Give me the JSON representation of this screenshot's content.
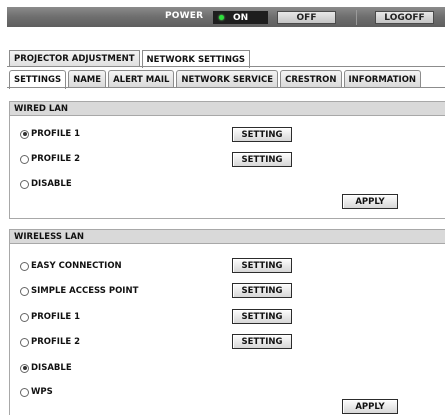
{
  "topbar": {
    "power_label": "POWER",
    "on_label": "ON",
    "off_label": "OFF",
    "logoff_label": "LOGOFF"
  },
  "main_tabs": [
    {
      "label": "PROJECTOR ADJUSTMENT",
      "active": false
    },
    {
      "label": "NETWORK SETTINGS",
      "active": true
    }
  ],
  "sub_tabs": [
    {
      "label": "SETTINGS",
      "active": true
    },
    {
      "label": "NAME",
      "active": false
    },
    {
      "label": "ALERT MAIL",
      "active": false
    },
    {
      "label": "NETWORK SERVICE",
      "active": false
    },
    {
      "label": "CRESTRON",
      "active": false
    },
    {
      "label": "INFORMATION",
      "active": false
    }
  ],
  "wired_lan": {
    "title": "WIRED LAN",
    "options": [
      {
        "label": "PROFILE 1",
        "checked": true,
        "button": "SETTING"
      },
      {
        "label": "PROFILE 2",
        "checked": false,
        "button": "SETTING"
      },
      {
        "label": "DISABLE",
        "checked": false
      }
    ],
    "apply_label": "APPLY"
  },
  "wireless_lan": {
    "title": "WIRELESS LAN",
    "options": [
      {
        "label": "EASY CONNECTION",
        "checked": false,
        "button": "SETTING"
      },
      {
        "label": "SIMPLE ACCESS POINT",
        "checked": false,
        "button": "SETTING"
      },
      {
        "label": "PROFILE 1",
        "checked": false,
        "button": "SETTING"
      },
      {
        "label": "PROFILE 2",
        "checked": false,
        "button": "SETTING"
      },
      {
        "label": "DISABLE",
        "checked": true
      },
      {
        "label": "WPS",
        "checked": false
      }
    ],
    "apply_label": "APPLY"
  },
  "colors": {
    "power_on_indicator": "#2ee03c",
    "topbar": "#6e6e6e",
    "panel_header": "#d9d9d9"
  }
}
